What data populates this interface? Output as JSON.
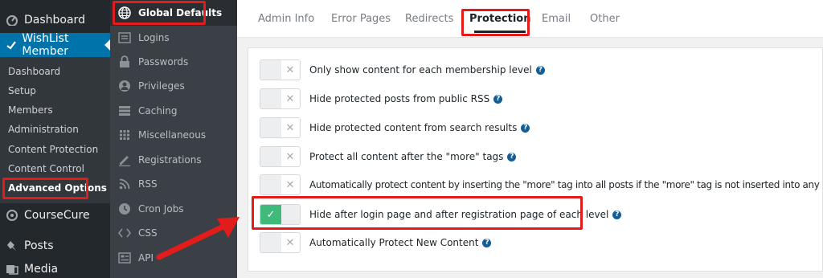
{
  "wp_menu": {
    "dashboard": "Dashboard",
    "wishlist": "WishList Member",
    "submenu": [
      "Dashboard",
      "Setup",
      "Members",
      "Administration",
      "Content Protection",
      "Content Control",
      "Advanced Options"
    ],
    "coursecure": "CourseCure",
    "posts": "Posts",
    "media": "Media"
  },
  "wl_nav": {
    "items": [
      {
        "label": "Global Defaults",
        "icon": "globe-icon"
      },
      {
        "label": "Logins",
        "icon": "login-list-icon"
      },
      {
        "label": "Passwords",
        "icon": "lock-icon"
      },
      {
        "label": "Privileges",
        "icon": "user-icon"
      },
      {
        "label": "Caching",
        "icon": "stack-icon"
      },
      {
        "label": "Miscellaneous",
        "icon": "grid-icon"
      },
      {
        "label": "Registrations",
        "icon": "pencil-icon"
      },
      {
        "label": "RSS",
        "icon": "rss-icon"
      },
      {
        "label": "Cron Jobs",
        "icon": "clock-icon"
      },
      {
        "label": "CSS",
        "icon": "code-icon"
      },
      {
        "label": "API",
        "icon": "api-icon"
      }
    ]
  },
  "tabs": [
    "Admin Info",
    "Error Pages",
    "Redirects",
    "Protection",
    "Email",
    "Other"
  ],
  "active_tab": "Protection",
  "options": [
    {
      "label": "Only show content for each membership level",
      "enabled": false
    },
    {
      "label": "Hide protected posts from public RSS",
      "enabled": false
    },
    {
      "label": "Hide protected content from search results",
      "enabled": false
    },
    {
      "label": "Protect all content after the \"more\" tags",
      "enabled": false
    },
    {
      "label": "Automatically protect content by inserting the \"more\" tag into all posts if the \"more\" tag is not inserted into any post",
      "enabled": false
    },
    {
      "label": "Hide after login page and after registration page of each level",
      "enabled": true
    },
    {
      "label": "Automatically Protect New Content",
      "enabled": false
    }
  ],
  "help_glyph": "?",
  "colors": {
    "accent_red": "#e21b1b",
    "toggle_on": "#3fba7a",
    "wp_blue": "#0073aa"
  }
}
